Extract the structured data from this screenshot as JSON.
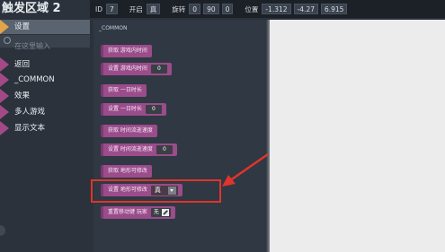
{
  "title": "触发区域 2",
  "properties": {
    "id_label": "ID",
    "id_value": "7",
    "enabled_label": "开启",
    "enabled_value": "真",
    "rotation_label": "旋转",
    "rotation_values": [
      "0",
      "90",
      "0"
    ],
    "position_label": "位置",
    "position_values": [
      "-1.312",
      "-4.27",
      "6.915"
    ]
  },
  "sidebar": {
    "settings_tab": "设置",
    "search_placeholder": "在这里输入",
    "items": [
      {
        "label": "返回"
      },
      {
        "label": "_COMMON"
      },
      {
        "label": "效果"
      },
      {
        "label": "多人游戏"
      },
      {
        "label": "显示文本"
      }
    ]
  },
  "palette": {
    "header": "_COMMON",
    "blocks": [
      {
        "label": "获取 游戏内时间"
      },
      {
        "label": "设置 游戏内时间",
        "slot": "0"
      },
      {
        "label": "获取 一日时长"
      },
      {
        "label": "设置 一日时长",
        "slot": "0"
      },
      {
        "label": "获取 时间流逝速度"
      },
      {
        "label": "设置 时间流逝速度",
        "slot": "0"
      },
      {
        "label": "获取 地形可修改"
      },
      {
        "label": "设置 地形可修改",
        "dropdown": "真"
      },
      {
        "label": "重置移动键 玩家",
        "slot": "无"
      }
    ]
  },
  "colors": {
    "block": "#9a4c8b",
    "highlight": "#e0342c",
    "tab_accent": "#e4a44a",
    "item_accent": "#a34a86"
  }
}
